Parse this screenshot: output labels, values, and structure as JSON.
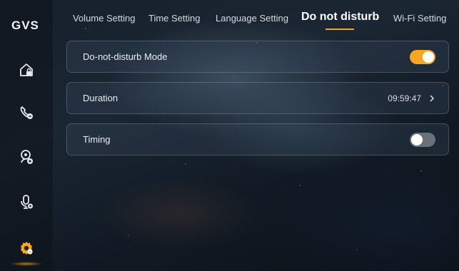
{
  "brand": {
    "logo": "GVS"
  },
  "sidebar": {
    "items": [
      {
        "name": "home-lock-icon",
        "active": false
      },
      {
        "name": "phone-icon",
        "active": false
      },
      {
        "name": "camera-person-icon",
        "active": false
      },
      {
        "name": "microphone-icon",
        "active": false
      },
      {
        "name": "settings-gear-icon",
        "active": true
      }
    ]
  },
  "tabs": [
    {
      "label": "Volume Setting",
      "active": false
    },
    {
      "label": "Time Setting",
      "active": false
    },
    {
      "label": "Language Setting",
      "active": false
    },
    {
      "label": "Do not disturb",
      "active": true
    },
    {
      "label": "Wi-Fi Setting",
      "active": false
    }
  ],
  "settings": {
    "dnd_mode": {
      "label": "Do-not-disturb Mode",
      "enabled": true
    },
    "duration": {
      "label": "Duration",
      "value": "09:59:47"
    },
    "timing": {
      "label": "Timing",
      "enabled": false
    }
  },
  "colors": {
    "accent": "#f5a623",
    "toggle_off": "#6b7078"
  }
}
